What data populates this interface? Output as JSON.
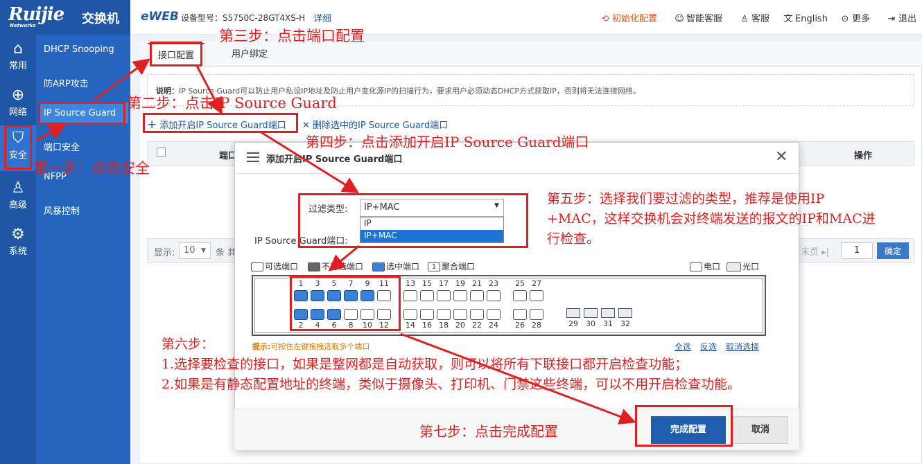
{
  "header": {
    "brand_logo": "Ruijie",
    "brand_sub": "Networks",
    "brand_title": "交换机",
    "eweb": "eWEB",
    "model_label": "设备型号：S5750C-28GT4XS-H",
    "detail_link": "详细",
    "init_config": "初始化配置",
    "smart_service": "智能客服",
    "service": "客服",
    "language": "English",
    "more": "更多",
    "logout": "退出",
    "init_color": "#e0501a"
  },
  "sidebar": {
    "items": [
      {
        "label": "常用",
        "icon": "home-icon"
      },
      {
        "label": "网络",
        "icon": "globe-icon"
      },
      {
        "label": "安全",
        "icon": "shield-icon"
      },
      {
        "label": "高级",
        "icon": "user-gear-icon"
      },
      {
        "label": "系统",
        "icon": "gear-icon"
      }
    ]
  },
  "subnav": {
    "items": [
      "DHCP Snooping",
      "防ARP攻击",
      "IP Source Guard",
      "端口安全",
      "NFPP",
      "风暴控制"
    ]
  },
  "tabs": [
    "接口配置",
    "用户绑定"
  ],
  "note": {
    "label": "说明：",
    "text": "IP Source Guard可以防止用户私设IP地址及防止用户变化源IP的扫描行为，要求用户必须动态DHCP方式获取IP，否则将无法连接网络。"
  },
  "actions": {
    "add": "添加开启IP Source Guard端口",
    "delete": "删除选中的IP Source Guard端口"
  },
  "table": {
    "col_port": "端口",
    "col_op": "操作"
  },
  "pager": {
    "show": "显示:",
    "size": "10",
    "records": "条 共",
    "last": "末页",
    "page": "1",
    "ok": "确定"
  },
  "modal": {
    "title": "添加开启IP Source Guard端口",
    "filter_label": "过滤类型:",
    "filter_value": "IP+MAC",
    "filter_options": [
      "IP",
      "IP+MAC"
    ],
    "isg_label": "IP Source Guard端口:",
    "legend": {
      "selectable": "可选端口",
      "unselectable": "不可选端口",
      "selected": "选中端口",
      "aggregate": "聚合端口",
      "electric": "电口",
      "optical": "光口",
      "aggregate_num": "1"
    },
    "ports_top": [
      "1",
      "3",
      "5",
      "7",
      "9",
      "11",
      "13",
      "15",
      "17",
      "19",
      "21",
      "23",
      "25",
      "27"
    ],
    "ports_bottom": [
      "2",
      "4",
      "6",
      "8",
      "10",
      "12",
      "14",
      "16",
      "18",
      "20",
      "22",
      "24",
      "26",
      "28"
    ],
    "ports_fiber": [
      "29",
      "30",
      "31",
      "32"
    ],
    "selected_top": [
      "1",
      "3",
      "5",
      "7",
      "9"
    ],
    "selected_bottom": [
      "2",
      "4",
      "6"
    ],
    "tip_label": "提示:",
    "tip_text": "可按住左键拖拽选取多个端口",
    "select_all": "全选",
    "invert": "反选",
    "cancel_select": "取消选择",
    "confirm": "完成配置",
    "cancel": "取消"
  },
  "annotations": {
    "step1": "第一步：点击安全",
    "step2": "第二步：点击IP Source Guard",
    "step3": "第三步：点击端口配置",
    "step4": "第四步：点击添加开启IP Source Guard端口",
    "step5_l1": "第五步：选择我们要过滤的类型，推荐是使用IP",
    "step5_l2": "+MAC，这样交换机会对终端发送的报文的IP和MAC进",
    "step5_l3": "行检查。",
    "step6_title": "第六步：",
    "step6_l1": "1.选择要检查的接口，如果是整网都是自动获取，则可以将所有下联接口都开启检查功能；",
    "step6_l2": "2.如果是有静态配置地址的终端，类似于摄像头、打印机、门禁这些终端，可以不用开启检查功能。",
    "step7": "第七步：点击完成配置",
    "color": "#e02020"
  }
}
